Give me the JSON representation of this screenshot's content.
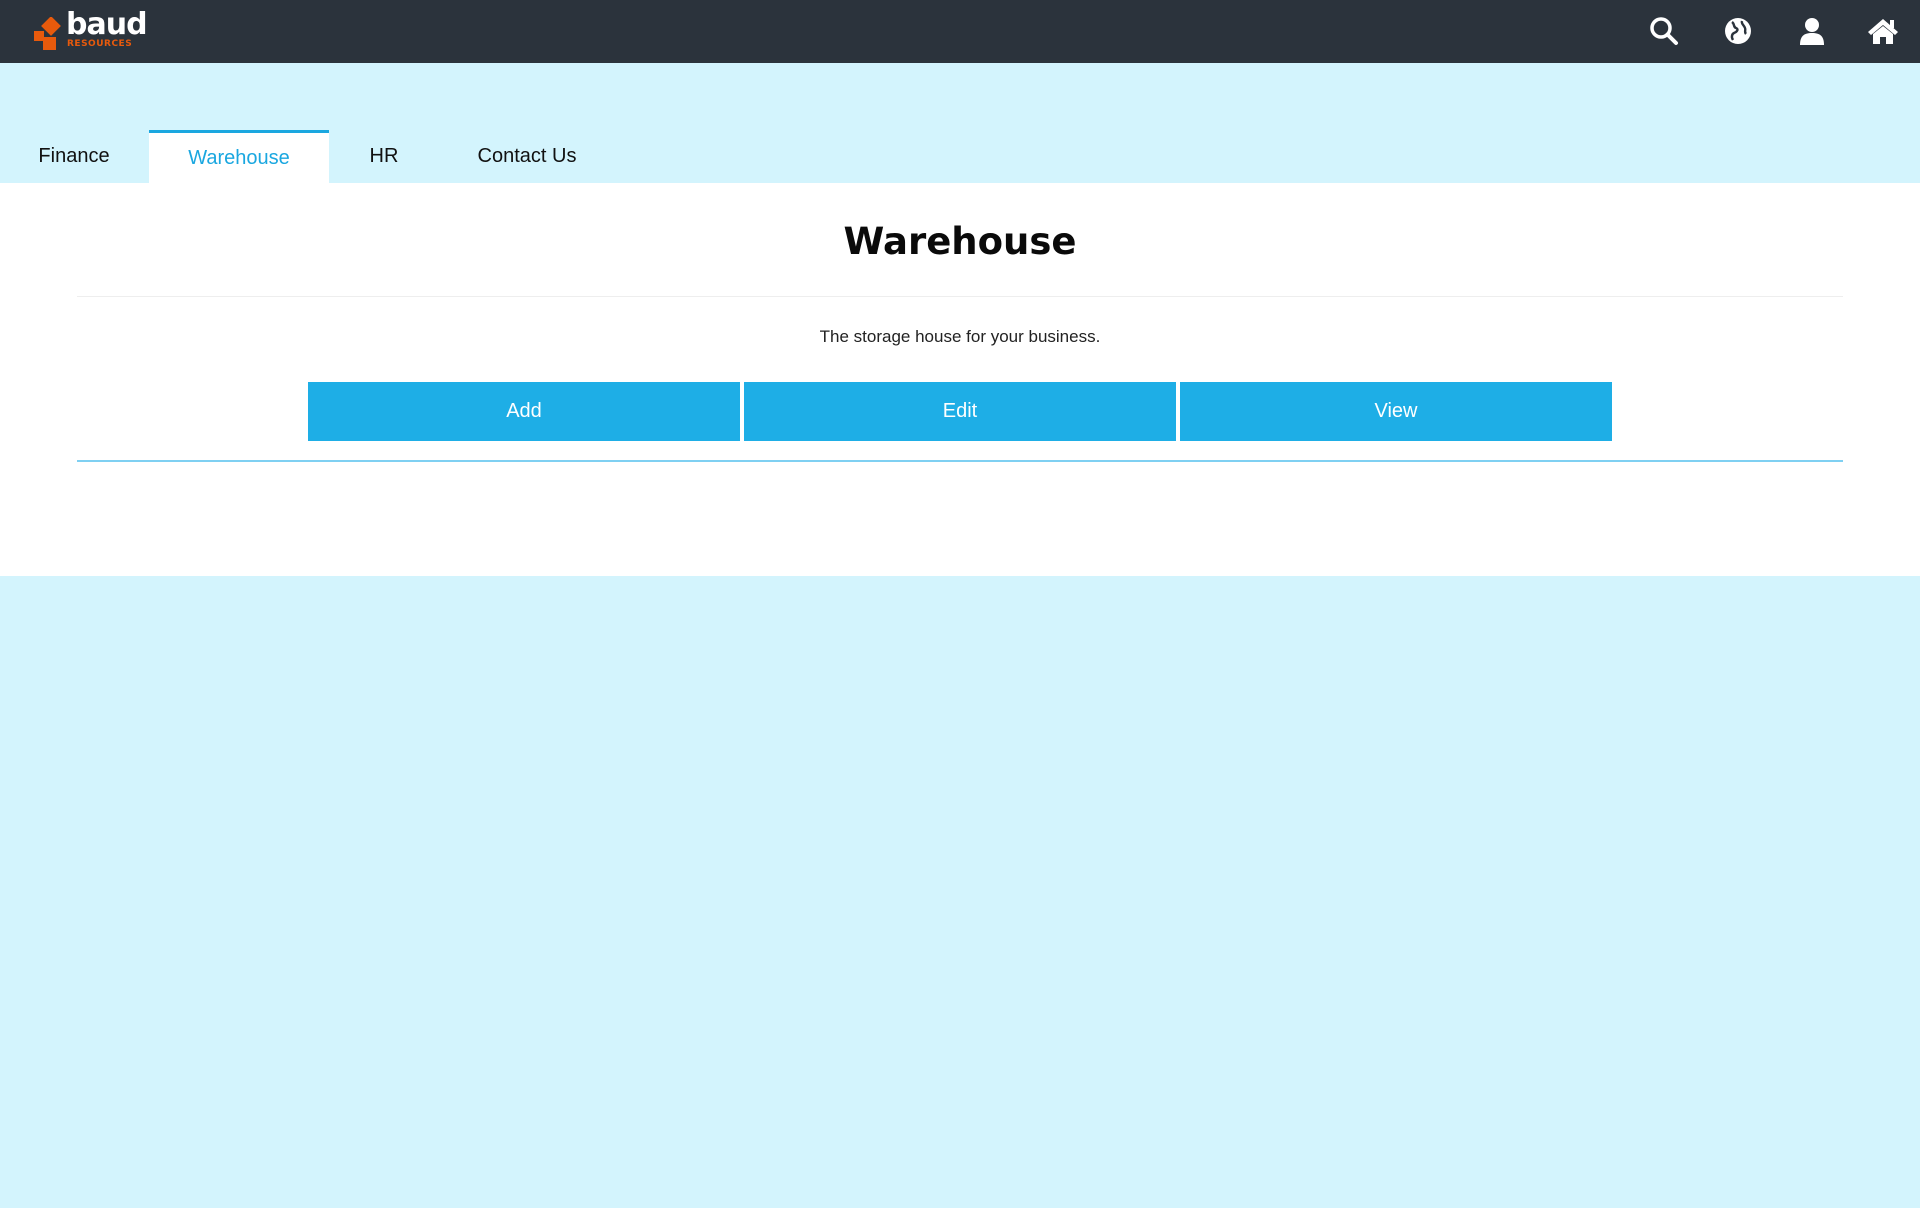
{
  "header": {
    "logo": {
      "word": "baud",
      "sub": "RESOURCES",
      "brand_color": "#e85a0c"
    },
    "icons": [
      "search-icon",
      "globe-icon",
      "user-icon",
      "home-icon"
    ],
    "background": "#2b333c"
  },
  "tabs": {
    "items": [
      {
        "label": "Finance",
        "active": false
      },
      {
        "label": "Warehouse",
        "active": true
      },
      {
        "label": "HR",
        "active": false
      },
      {
        "label": "Contact Us",
        "active": false
      }
    ],
    "active_color": "#1aa7e0"
  },
  "main": {
    "title": "Warehouse",
    "subtitle": "The storage house for your business.",
    "buttons": {
      "add": "Add",
      "edit": "Edit",
      "view": "View"
    },
    "button_color": "#1eaee6"
  },
  "page": {
    "background": "#d3f4fd"
  }
}
